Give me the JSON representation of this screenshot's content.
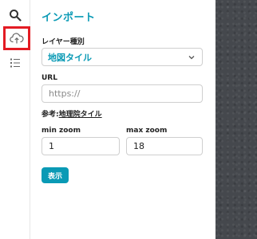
{
  "toolbar": {
    "items": [
      {
        "name": "search-icon"
      },
      {
        "name": "cloud-upload-icon",
        "active": true
      },
      {
        "name": "list-icon"
      }
    ]
  },
  "panel": {
    "title": "インポート",
    "layer_type_label": "レイヤー種別",
    "layer_type_value": "地図タイル",
    "url_label": "URL",
    "url_value": "",
    "url_placeholder": "https://",
    "reference_prefix": "参考:",
    "reference_link": "地理院タイル",
    "min_zoom_label": "min zoom",
    "min_zoom_value": "1",
    "max_zoom_label": "max zoom",
    "max_zoom_value": "18",
    "show_button": "表示"
  },
  "colors": {
    "accent": "#0a9ab5",
    "highlight": "#e31b23"
  }
}
